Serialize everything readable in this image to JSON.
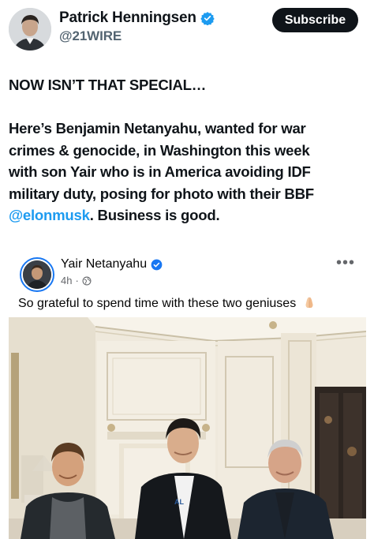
{
  "header": {
    "display_name": "Patrick Henningsen",
    "handle": "@21WIRE",
    "subscribe_label": "Subscribe"
  },
  "tweet": {
    "headline": "NOW ISN’T THAT SPECIAL…",
    "lines": [
      "Here’s Benjamin Netanyahu, wanted for war",
      "crimes & genocide, in Washington this week",
      "with son Yair who is in America avoiding IDF",
      "military duty, posing for photo with their BBF"
    ],
    "mention": "@elonmusk",
    "after_mention": ". Business is good."
  },
  "fb_post": {
    "author": "Yair Netanyahu",
    "age": "4h",
    "separator": "·",
    "caption": "So grateful to spend time with these two geniuses",
    "caption_emoji": "folded-hands-icon",
    "photo_shirt_text": "AL"
  },
  "colors": {
    "x_verified": "#1d9bf0",
    "fb_verified": "#1877f2",
    "mention": "#1d9bf0",
    "subscribe_bg": "#0f1419"
  }
}
